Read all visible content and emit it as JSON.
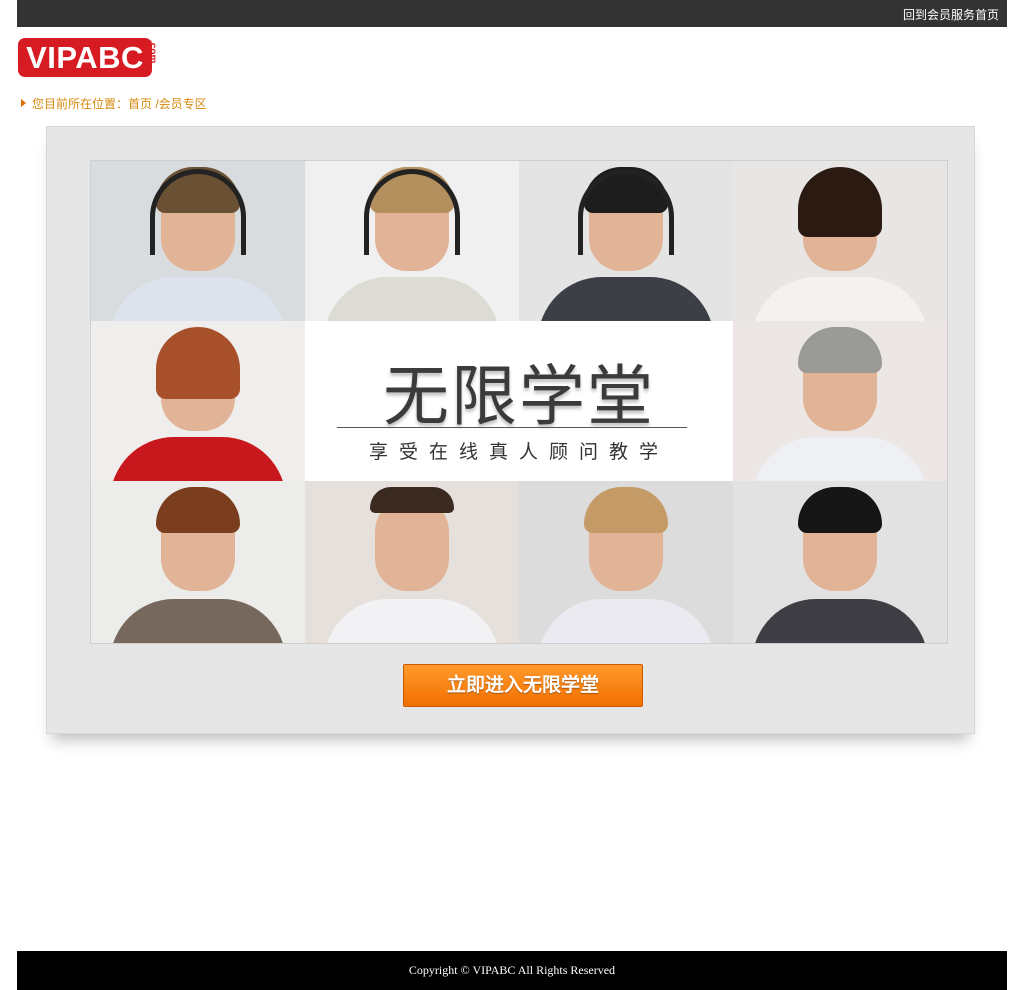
{
  "header": {
    "home_link": "回到会员服务首页"
  },
  "logo": {
    "text": "VIPABC",
    "suffix": ".com"
  },
  "breadcrumb": {
    "text": "您目前所在位置：首页 /会员专区"
  },
  "banner": {
    "title": "无限学堂",
    "subtitle": "享受在线真人顾问教学",
    "icons": {
      "consultants": [
        "consultant-1-headset-photo",
        "consultant-2-headset-photo",
        "consultant-3-headset-photo",
        "consultant-4-photo",
        "consultant-5-glasses-photo",
        "consultant-6-photo",
        "consultant-7-photo",
        "consultant-8-glasses-photo",
        "consultant-9-photo",
        "consultant-10-photo"
      ]
    }
  },
  "actions": {
    "enter_label": "立即进入无限学堂"
  },
  "footer": {
    "copyright": "Copyright © VIPABC All Rights Reserved"
  },
  "colors": {
    "topbar": "#333333",
    "brand_red": "#d61c22",
    "breadcrumb": "#d88a0f",
    "button_orange": "#f57b0c",
    "footer": "#000000"
  }
}
